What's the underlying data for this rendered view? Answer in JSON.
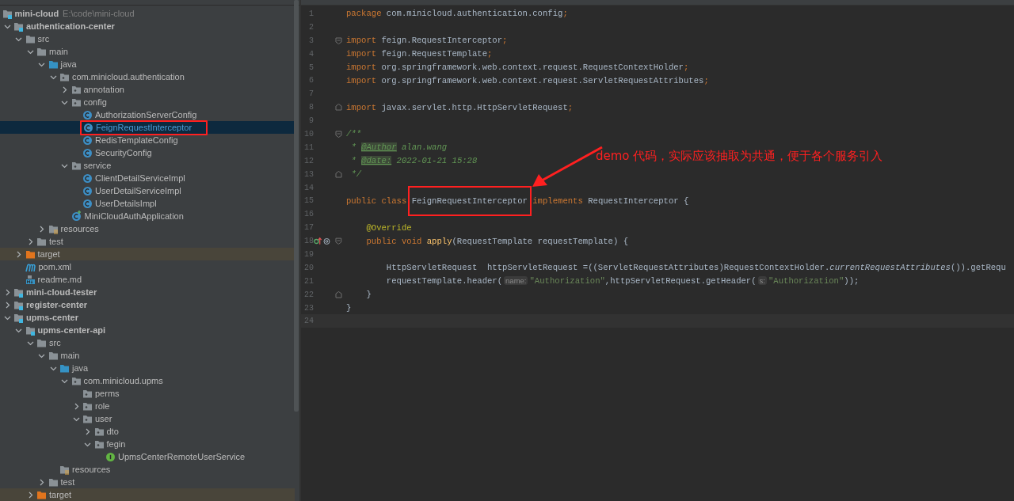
{
  "project_tree": {
    "items": [
      {
        "label": "mini-cloud",
        "kind": "module",
        "bold": true,
        "path_hint": "E:\\code\\mini-cloud",
        "selected": false,
        "children": [
          {
            "label": "authentication-center",
            "kind": "module",
            "bold": true,
            "expanded": true,
            "selected": false,
            "children": [
              {
                "label": "src",
                "kind": "folder",
                "expanded": true,
                "selected": false,
                "children": [
                  {
                    "label": "main",
                    "kind": "folder",
                    "expanded": true,
                    "selected": false,
                    "children": [
                      {
                        "label": "java",
                        "kind": "source-folder",
                        "expanded": true,
                        "selected": false,
                        "children": [
                          {
                            "label": "com.minicloud.authentication",
                            "kind": "package",
                            "expanded": true,
                            "selected": false,
                            "children": [
                              {
                                "label": "annotation",
                                "kind": "package",
                                "expanded": false,
                                "selected": false
                              },
                              {
                                "label": "config",
                                "kind": "package",
                                "expanded": true,
                                "selected": false,
                                "children": [
                                  {
                                    "label": "AuthorizationServerConfig",
                                    "kind": "class",
                                    "selected": false
                                  },
                                  {
                                    "label": "FeignRequestInterceptor",
                                    "kind": "class",
                                    "selected": true,
                                    "marked": true
                                  },
                                  {
                                    "label": "RedisTemplateConfig",
                                    "kind": "class",
                                    "selected": false
                                  },
                                  {
                                    "label": "SecurityConfig",
                                    "kind": "class",
                                    "selected": false
                                  }
                                ]
                              },
                              {
                                "label": "service",
                                "kind": "package",
                                "expanded": true,
                                "selected": false,
                                "children": [
                                  {
                                    "label": "ClientDetailServiceImpl",
                                    "kind": "class",
                                    "selected": false
                                  },
                                  {
                                    "label": "UserDetailServiceImpl",
                                    "kind": "class",
                                    "selected": false
                                  },
                                  {
                                    "label": "UserDetailsImpl",
                                    "kind": "class",
                                    "selected": false
                                  }
                                ]
                              },
                              {
                                "label": "MiniCloudAuthApplication",
                                "kind": "application",
                                "selected": false
                              }
                            ]
                          }
                        ]
                      },
                      {
                        "label": "resources",
                        "kind": "resources",
                        "expanded": false,
                        "selected": false
                      }
                    ]
                  },
                  {
                    "label": "test",
                    "kind": "folder",
                    "expanded": false,
                    "selected": false
                  }
                ]
              },
              {
                "label": "target",
                "kind": "excluded-folder",
                "expanded": false,
                "selected": false
              },
              {
                "label": "pom.xml",
                "kind": "maven",
                "selected": false
              },
              {
                "label": "readme.md",
                "kind": "markdown",
                "selected": false
              }
            ]
          },
          {
            "label": "mini-cloud-tester",
            "kind": "module",
            "bold": true,
            "expanded": false,
            "selected": false
          },
          {
            "label": "register-center",
            "kind": "module",
            "bold": true,
            "expanded": false,
            "selected": false
          },
          {
            "label": "upms-center",
            "kind": "module",
            "bold": true,
            "expanded": true,
            "selected": false,
            "children": [
              {
                "label": "upms-center-api",
                "kind": "module",
                "bold": true,
                "expanded": true,
                "selected": false,
                "children": [
                  {
                    "label": "src",
                    "kind": "folder",
                    "expanded": true,
                    "selected": false,
                    "children": [
                      {
                        "label": "main",
                        "kind": "folder",
                        "expanded": true,
                        "selected": false,
                        "children": [
                          {
                            "label": "java",
                            "kind": "source-folder",
                            "expanded": true,
                            "selected": false,
                            "children": [
                              {
                                "label": "com.minicloud.upms",
                                "kind": "package",
                                "expanded": true,
                                "selected": false,
                                "children": [
                                  {
                                    "label": "perms",
                                    "kind": "package",
                                    "selected": false
                                  },
                                  {
                                    "label": "role",
                                    "kind": "package",
                                    "expanded": false,
                                    "selected": false
                                  },
                                  {
                                    "label": "user",
                                    "kind": "package",
                                    "expanded": true,
                                    "selected": false,
                                    "children": [
                                      {
                                        "label": "dto",
                                        "kind": "package",
                                        "expanded": false,
                                        "selected": false
                                      },
                                      {
                                        "label": "fegin",
                                        "kind": "package",
                                        "expanded": true,
                                        "selected": false,
                                        "children": [
                                          {
                                            "label": "UpmsCenterRemoteUserService",
                                            "kind": "interface",
                                            "selected": false
                                          }
                                        ]
                                      }
                                    ]
                                  }
                                ]
                              }
                            ]
                          },
                          {
                            "label": "resources",
                            "kind": "resources",
                            "selected": false
                          }
                        ]
                      },
                      {
                        "label": "test",
                        "kind": "folder",
                        "expanded": false,
                        "selected": false
                      }
                    ]
                  },
                  {
                    "label": "target",
                    "kind": "excluded-folder",
                    "expanded": false,
                    "selected": false
                  }
                ]
              }
            ]
          }
        ]
      }
    ]
  },
  "editor": {
    "lines": [
      {
        "number": "1",
        "segments": [
          {
            "kind": "keyword",
            "text": "package"
          },
          {
            "kind": "plain",
            "text": " com.minicloud.authentication.config"
          },
          {
            "kind": "keyword",
            "text": ";"
          }
        ]
      },
      {
        "number": "2"
      },
      {
        "number": "3",
        "fold_start": true,
        "segments": [
          {
            "kind": "keyword",
            "text": "import"
          },
          {
            "kind": "plain",
            "text": " feign.RequestInterceptor"
          },
          {
            "kind": "keyword",
            "text": ";"
          }
        ]
      },
      {
        "number": "4",
        "segments": [
          {
            "kind": "keyword",
            "text": "import"
          },
          {
            "kind": "plain",
            "text": " feign.RequestTemplate"
          },
          {
            "kind": "keyword",
            "text": ";"
          }
        ]
      },
      {
        "number": "5",
        "segments": [
          {
            "kind": "keyword",
            "text": "import"
          },
          {
            "kind": "plain",
            "text": " org.springframework.web.context.request.RequestContextHolder"
          },
          {
            "kind": "keyword",
            "text": ";"
          }
        ]
      },
      {
        "number": "6",
        "segments": [
          {
            "kind": "keyword",
            "text": "import"
          },
          {
            "kind": "plain",
            "text": " org.springframework.web.context.request.ServletRequestAttributes"
          },
          {
            "kind": "keyword",
            "text": ";"
          }
        ]
      },
      {
        "number": "7"
      },
      {
        "number": "8",
        "fold_end": true,
        "segments": [
          {
            "kind": "keyword",
            "text": "import"
          },
          {
            "kind": "plain",
            "text": " javax.servlet.http.HttpServletRequest"
          },
          {
            "kind": "keyword",
            "text": ";"
          }
        ]
      },
      {
        "number": "9"
      },
      {
        "number": "10",
        "fold_start": true,
        "segments": [
          {
            "kind": "comment",
            "text": "/**"
          }
        ]
      },
      {
        "number": "11",
        "segments": [
          {
            "kind": "comment",
            "text": " * "
          },
          {
            "kind": "doc-tag",
            "text": "@Author"
          },
          {
            "kind": "comment",
            "text": " alan.wang"
          }
        ]
      },
      {
        "number": "12",
        "segments": [
          {
            "kind": "comment",
            "text": " * "
          },
          {
            "kind": "doc-tag",
            "text": "@date:"
          },
          {
            "kind": "comment",
            "text": " 2022-01-21 15:28"
          }
        ]
      },
      {
        "number": "13",
        "fold_end": true,
        "segments": [
          {
            "kind": "comment",
            "text": " */"
          }
        ]
      },
      {
        "number": "14"
      },
      {
        "number": "15",
        "segments": [
          {
            "kind": "keyword",
            "text": "public class "
          },
          {
            "kind": "plain",
            "text": "FeignRequestInterceptor",
            "marked": true
          },
          {
            "kind": "keyword",
            "text": " implements"
          },
          {
            "kind": "plain",
            "text": " RequestInterceptor {"
          }
        ]
      },
      {
        "number": "16"
      },
      {
        "number": "17",
        "segments": [
          {
            "kind": "annotation",
            "text": "    @Override"
          }
        ]
      },
      {
        "number": "18",
        "fold_start": true,
        "override_marker": true,
        "segments": [
          {
            "kind": "keyword",
            "text": "    public void "
          },
          {
            "kind": "method",
            "text": "apply"
          },
          {
            "kind": "plain",
            "text": "(RequestTemplate requestTemplate) {"
          }
        ]
      },
      {
        "number": "19"
      },
      {
        "number": "20",
        "segments": [
          {
            "kind": "plain",
            "text": "        HttpServletRequest  httpServletRequest =((ServletRequestAttributes)RequestContextHolder."
          },
          {
            "kind": "static-call",
            "text": "currentRequestAttributes"
          },
          {
            "kind": "plain",
            "text": "()).getRequ"
          }
        ]
      },
      {
        "number": "21",
        "segments": [
          {
            "kind": "plain",
            "text": "        requestTemplate.header("
          },
          {
            "kind": "hint",
            "text": "name:"
          },
          {
            "kind": "string",
            "text": "\"Authorization\""
          },
          {
            "kind": "plain",
            "text": ",httpServletRequest.getHeader("
          },
          {
            "kind": "hint",
            "text": "s:"
          },
          {
            "kind": "string",
            "text": "\"Authorization\""
          },
          {
            "kind": "plain",
            "text": "));"
          }
        ]
      },
      {
        "number": "22",
        "fold_end": true,
        "segments": [
          {
            "kind": "plain",
            "text": "    }"
          }
        ]
      },
      {
        "number": "23",
        "segments": [
          {
            "kind": "plain",
            "text": "}"
          }
        ]
      },
      {
        "number": "24",
        "current": true
      }
    ],
    "callout": {
      "text": "demo 代码，实际应该抽取为共通，便于各个服务引入"
    }
  }
}
